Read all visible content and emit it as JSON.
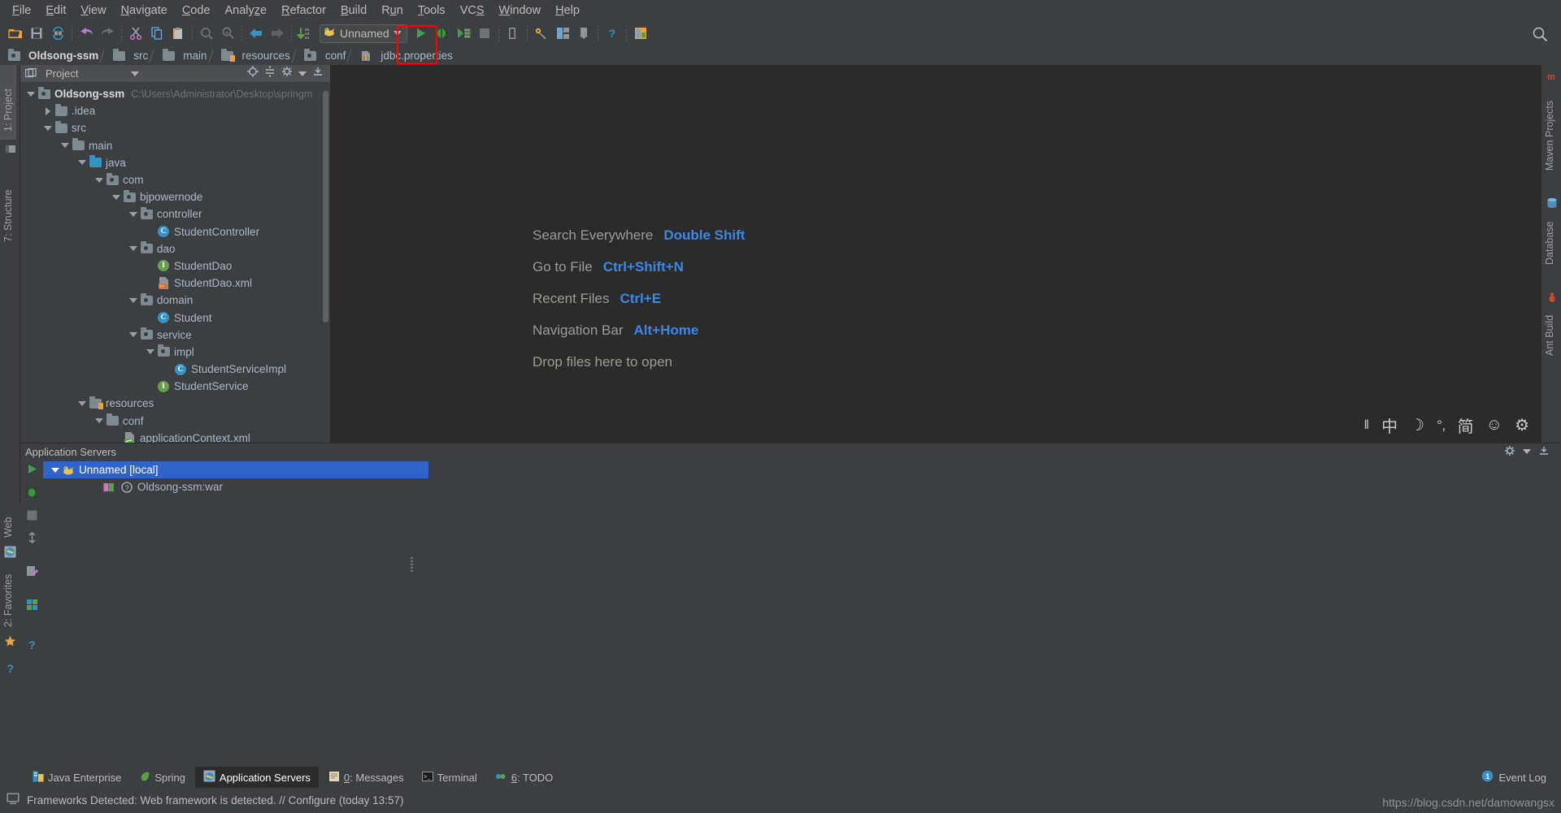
{
  "menubar": {
    "items": [
      {
        "label": "File",
        "mnemonic": "F"
      },
      {
        "label": "Edit",
        "mnemonic": "E"
      },
      {
        "label": "View",
        "mnemonic": "V"
      },
      {
        "label": "Navigate",
        "mnemonic": "N"
      },
      {
        "label": "Code",
        "mnemonic": "C"
      },
      {
        "label": "Analyze",
        "mnemonic": "z"
      },
      {
        "label": "Refactor",
        "mnemonic": "R"
      },
      {
        "label": "Build",
        "mnemonic": "B"
      },
      {
        "label": "Run",
        "mnemonic": "u"
      },
      {
        "label": "Tools",
        "mnemonic": "T"
      },
      {
        "label": "VCS",
        "mnemonic": "S"
      },
      {
        "label": "Window",
        "mnemonic": "W"
      },
      {
        "label": "Help",
        "mnemonic": "H"
      }
    ]
  },
  "toolbar": {
    "icons": [
      "open-folder-icon",
      "save-all-icon",
      "sync-icon",
      "undo-icon",
      "redo-icon",
      "cut-icon",
      "copy-icon",
      "paste-icon",
      "find-icon",
      "replace-icon",
      "back-icon",
      "forward-icon",
      "jump-to-source-icon"
    ],
    "run_config_label": "Unnamed",
    "run_config_icon": "tomcat-icon",
    "run_button": "run-icon",
    "debug_button": "debug-icon",
    "coverage_button": "run-with-coverage-icon",
    "stop_button": "stop-icon",
    "exit_button": "exit-icon",
    "settings_button": "settings-icon",
    "structure_button": "project-structure-icon",
    "updates_button": "update-icon",
    "help_button": "help-icon",
    "extras_button": "plugins-icon",
    "search_button": "search-everywhere-icon",
    "highlight_color": "#ff0000"
  },
  "breadcrumb": {
    "items": [
      {
        "label": "Oldsong-ssm",
        "icon": "module-folder-icon"
      },
      {
        "label": "src",
        "icon": "folder-icon"
      },
      {
        "label": "main",
        "icon": "folder-icon"
      },
      {
        "label": "resources",
        "icon": "resources-folder-icon"
      },
      {
        "label": "conf",
        "icon": "folder-icon"
      },
      {
        "label": "jdbc.properties",
        "icon": "properties-file-icon"
      }
    ]
  },
  "left_stripe": {
    "tabs": [
      {
        "label": "1: Project",
        "active": true,
        "icon": "project-icon"
      },
      {
        "label": "7: Structure",
        "active": false,
        "icon": "structure-icon"
      },
      {
        "label": "Web",
        "active": false,
        "icon": "web-icon"
      },
      {
        "label": "2: Favorites",
        "active": false,
        "icon": "favorites-icon"
      }
    ]
  },
  "right_stripe": {
    "tabs": [
      {
        "label": "Maven Projects",
        "icon": "maven-icon"
      },
      {
        "label": "Database",
        "icon": "database-icon"
      },
      {
        "label": "Ant Build",
        "icon": "ant-icon"
      }
    ]
  },
  "project_panel": {
    "title": "Project",
    "header_icons": [
      "target-icon",
      "collapse-all-icon",
      "gear-icon",
      "hide-icon"
    ],
    "tree": [
      {
        "depth": 0,
        "twisty": "down",
        "icon": "module-folder-icon",
        "label": "Oldsong-ssm",
        "path": "C:\\Users\\Administrator\\Desktop\\springm",
        "root": true
      },
      {
        "depth": 1,
        "twisty": "right",
        "icon": "folder-icon",
        "label": ".idea"
      },
      {
        "depth": 1,
        "twisty": "down",
        "icon": "folder-icon",
        "label": "src"
      },
      {
        "depth": 2,
        "twisty": "down",
        "icon": "folder-icon",
        "label": "main"
      },
      {
        "depth": 3,
        "twisty": "down",
        "icon": "source-folder-icon",
        "label": "java"
      },
      {
        "depth": 4,
        "twisty": "down",
        "icon": "package-icon",
        "label": "com"
      },
      {
        "depth": 5,
        "twisty": "down",
        "icon": "package-icon",
        "label": "bjpowernode"
      },
      {
        "depth": 6,
        "twisty": "down",
        "icon": "package-icon",
        "label": "controller"
      },
      {
        "depth": 7,
        "twisty": "none",
        "icon": "java-class-icon",
        "label": "StudentController"
      },
      {
        "depth": 6,
        "twisty": "down",
        "icon": "package-icon",
        "label": "dao"
      },
      {
        "depth": 7,
        "twisty": "none",
        "icon": "java-interface-icon",
        "label": "StudentDao"
      },
      {
        "depth": 7,
        "twisty": "none",
        "icon": "xml-file-icon",
        "label": "StudentDao.xml"
      },
      {
        "depth": 6,
        "twisty": "down",
        "icon": "package-icon",
        "label": "domain"
      },
      {
        "depth": 7,
        "twisty": "none",
        "icon": "java-class-icon",
        "label": "Student"
      },
      {
        "depth": 6,
        "twisty": "down",
        "icon": "package-icon",
        "label": "service"
      },
      {
        "depth": 7,
        "twisty": "down",
        "icon": "package-icon",
        "label": "impl"
      },
      {
        "depth": 8,
        "twisty": "none",
        "icon": "java-class-icon",
        "label": "StudentServiceImpl"
      },
      {
        "depth": 7,
        "twisty": "none",
        "icon": "java-interface-icon",
        "label": "StudentService"
      },
      {
        "depth": 3,
        "twisty": "down",
        "icon": "resources-folder-icon",
        "label": "resources"
      },
      {
        "depth": 4,
        "twisty": "down",
        "icon": "folder-icon",
        "label": "conf"
      },
      {
        "depth": 5,
        "twisty": "none",
        "icon": "spring-xml-icon",
        "label": "applicationContext.xml"
      }
    ]
  },
  "editor": {
    "welcome_rows": [
      {
        "label": "Search Everywhere",
        "shortcut": "Double Shift"
      },
      {
        "label": "Go to File",
        "shortcut": "Ctrl+Shift+N"
      },
      {
        "label": "Recent Files",
        "shortcut": "Ctrl+E"
      },
      {
        "label": "Navigation Bar",
        "shortcut": "Alt+Home"
      },
      {
        "label": "Drop files here to open",
        "shortcut": ""
      }
    ],
    "ime_items": [
      {
        "glyph": "‖",
        "name": "ime-handle-icon"
      },
      {
        "glyph": "中",
        "name": "ime-chinese-mode-icon"
      },
      {
        "glyph": "☽",
        "name": "ime-halfwidth-icon"
      },
      {
        "glyph": "°‚",
        "name": "ime-punctuation-icon"
      },
      {
        "glyph": "简",
        "name": "ime-simplified-icon"
      },
      {
        "glyph": "☺",
        "name": "ime-emoji-icon"
      },
      {
        "glyph": "⚙",
        "name": "ime-settings-icon"
      }
    ]
  },
  "app_servers": {
    "title": "Application Servers",
    "header_icons": [
      "gear-icon",
      "hide-icon"
    ],
    "gutter_icons": [
      "rerun-icon",
      "debug-icon",
      "stop-icon",
      "deploy-icon",
      "edit-config-icon",
      "settings2-icon",
      "help-icon"
    ],
    "rows": [
      {
        "depth": 0,
        "twisty": "down",
        "icon": "tomcat-icon",
        "label": "Unnamed [local]",
        "selected": true
      },
      {
        "depth": 1,
        "twisty": "none",
        "icon": "artifact-icon",
        "label": "Oldsong-ssm:war",
        "selected": false
      }
    ]
  },
  "bottom_tabs": {
    "items": [
      {
        "label": "Java Enterprise",
        "icon": "java-enterprise-icon",
        "active": false,
        "mnemonic": ""
      },
      {
        "label": "Spring",
        "icon": "spring-icon",
        "active": false,
        "mnemonic": ""
      },
      {
        "label": "Application Servers",
        "icon": "app-servers-icon",
        "active": true,
        "mnemonic": ""
      },
      {
        "label": "0: Messages",
        "icon": "messages-icon",
        "active": false,
        "mnemonic": "0"
      },
      {
        "label": "Terminal",
        "icon": "terminal-icon",
        "active": false,
        "mnemonic": ""
      },
      {
        "label": "6: TODO",
        "icon": "todo-icon",
        "active": false,
        "mnemonic": "6"
      }
    ],
    "event_log": {
      "label": "Event Log",
      "icon": "event-log-icon",
      "badge": "1"
    }
  },
  "statusbar": {
    "icon": "notification-icon",
    "message": "Frameworks Detected: Web framework is detected. // Configure (today 13:57)",
    "watermark": "https://blog.csdn.net/damowangsx"
  }
}
